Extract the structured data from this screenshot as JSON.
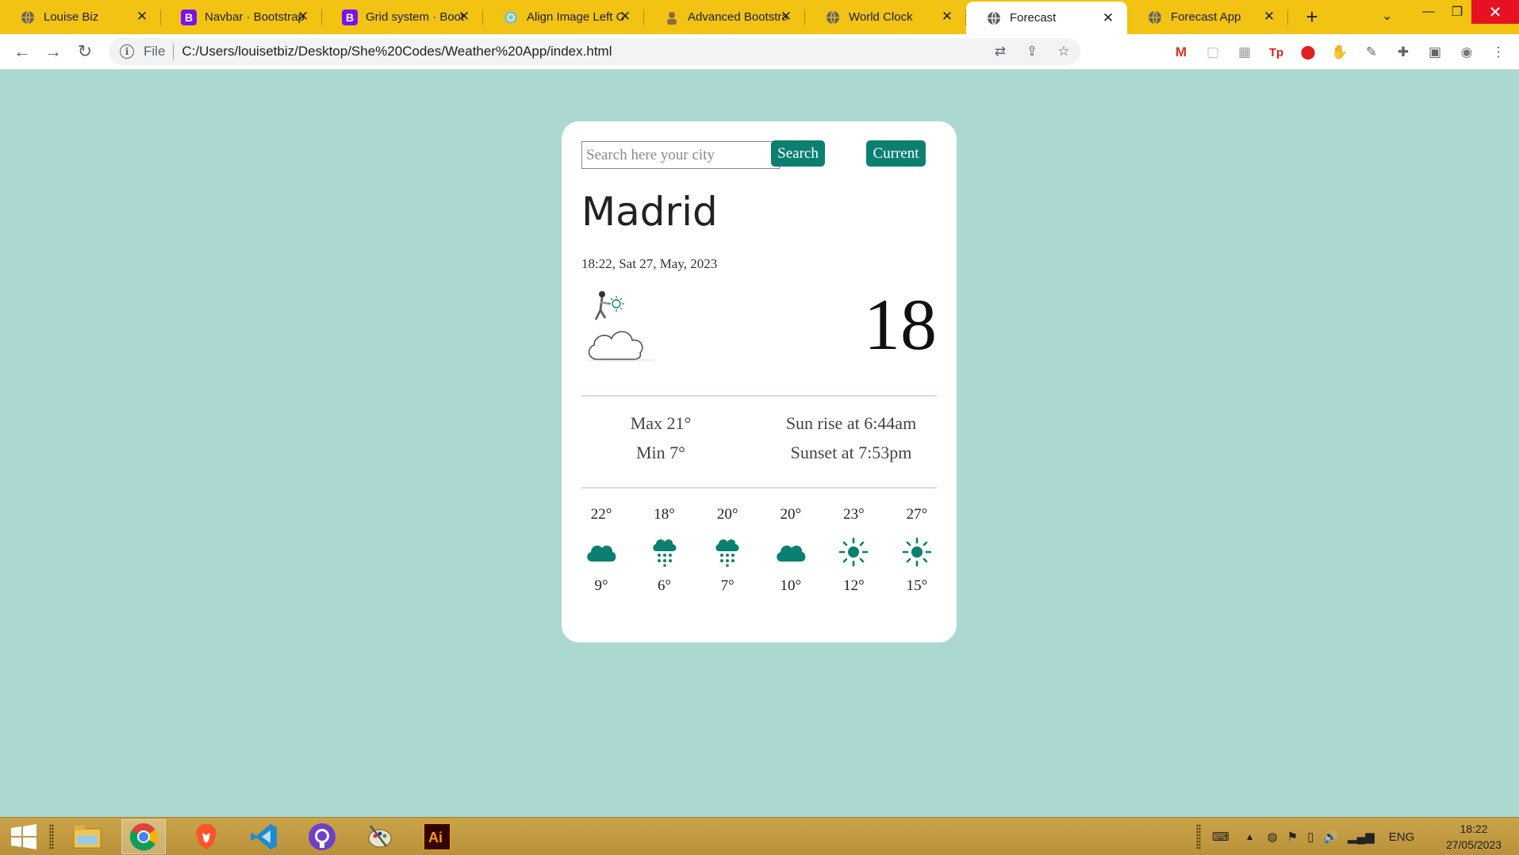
{
  "browser": {
    "tabs": [
      {
        "title": "Louise Biz",
        "favicon": "globe-icon"
      },
      {
        "title": "Navbar · Bootstrap",
        "favicon": "bootstrap-icon"
      },
      {
        "title": "Grid system · Bootstrap",
        "favicon": "bootstrap-icon"
      },
      {
        "title": "Align Image Left C",
        "favicon": "openai-icon"
      },
      {
        "title": "Advanced Bootstrap",
        "favicon": "user-icon"
      },
      {
        "title": "World Clock",
        "favicon": "globe-icon"
      },
      {
        "title": "Forecast",
        "favicon": "globe-icon",
        "active": true
      },
      {
        "title": "Forecast App",
        "favicon": "globe-icon"
      }
    ],
    "address": {
      "scheme": "File",
      "url": "C:/Users/louisetbiz/Desktop/She%20Codes/Weather%20App/index.html"
    },
    "colors": {
      "tabstrip": "#f2c313",
      "brand": "#0b8070"
    }
  },
  "weather": {
    "search_placeholder": "Search here your city",
    "search_label": "Search",
    "current_label": "Current",
    "city": "Madrid",
    "datetime": "18:22, Sat 27, May, 2023",
    "temperature": "18",
    "max": "Max 21°",
    "min": "Min 7°",
    "sunrise": "Sun rise at 6:44am",
    "sunset": "Sunset at 7:53pm",
    "forecast": [
      {
        "high": "22°",
        "low": "9°",
        "icon": "cloud-icon"
      },
      {
        "high": "18°",
        "low": "6°",
        "icon": "rain-icon"
      },
      {
        "high": "20°",
        "low": "7°",
        "icon": "rain-icon"
      },
      {
        "high": "20°",
        "low": "10°",
        "icon": "cloud-icon"
      },
      {
        "high": "23°",
        "low": "12°",
        "icon": "sun-icon"
      },
      {
        "high": "27°",
        "low": "15°",
        "icon": "sun-icon"
      }
    ]
  },
  "taskbar": {
    "apps": [
      "windows-start-icon",
      "file-explorer-icon",
      "chrome-icon",
      "brave-icon",
      "vscode-icon",
      "github-icon",
      "paint-icon",
      "illustrator-icon"
    ],
    "illustrator_label": "Ai",
    "language": "ENG",
    "time": "18:22",
    "date": "27/05/2023"
  }
}
